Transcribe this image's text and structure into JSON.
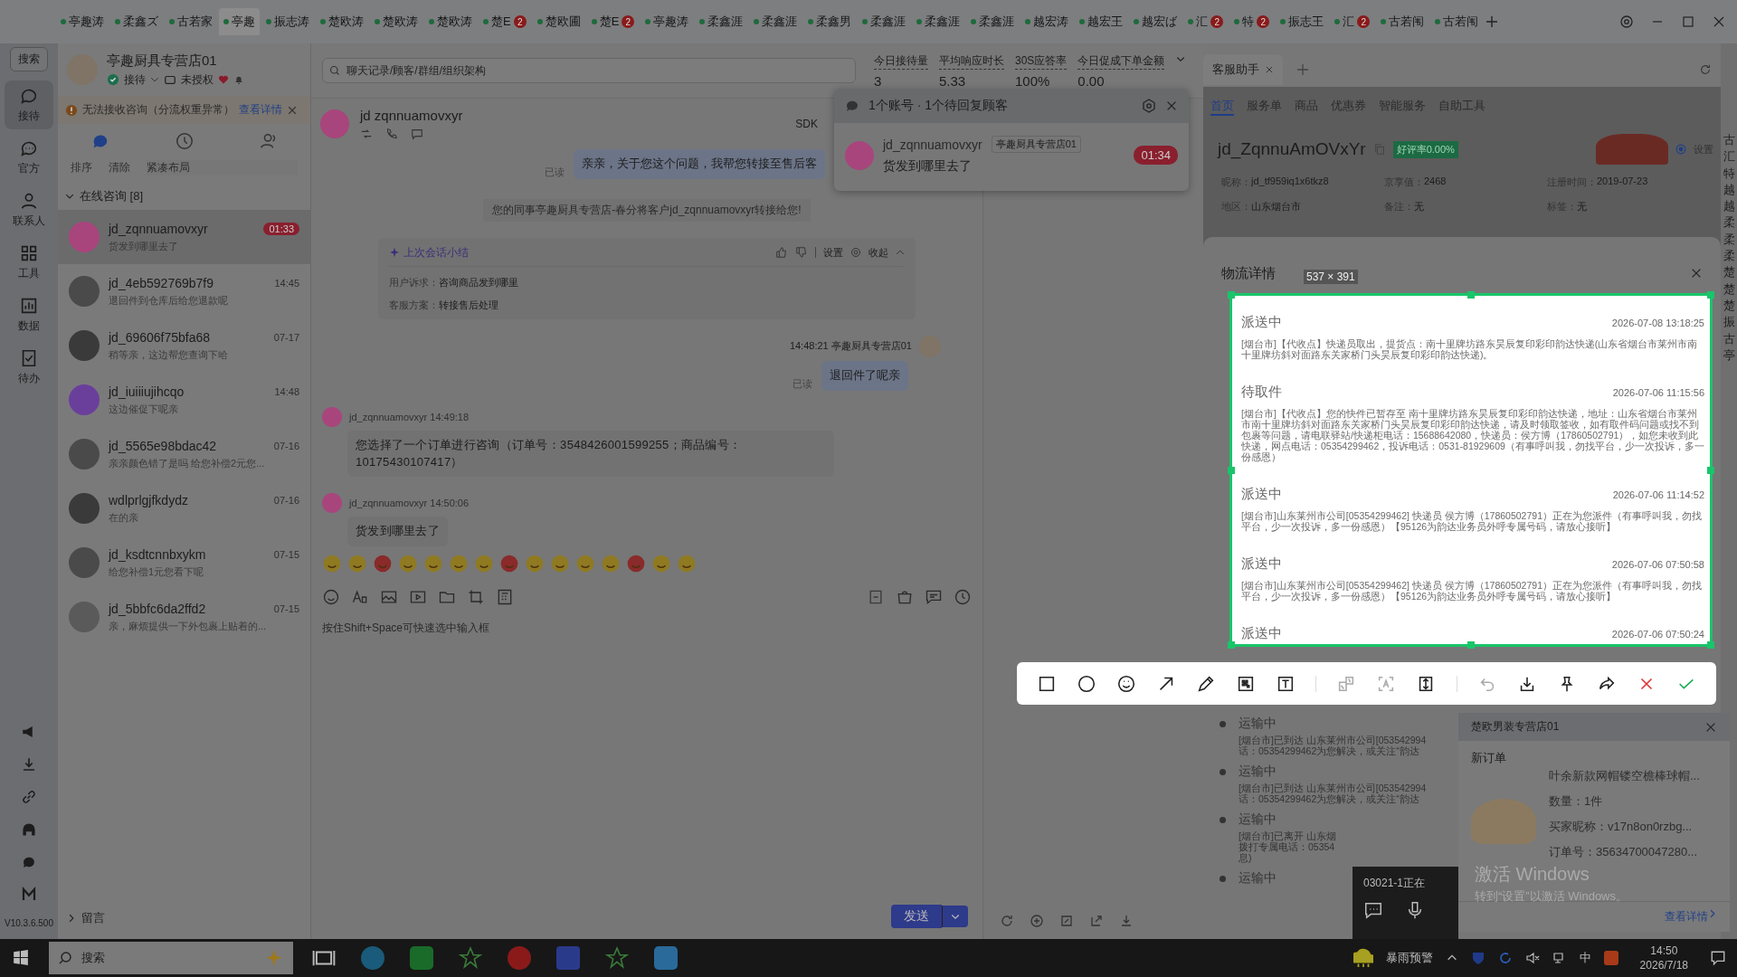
{
  "top_tabs": [
    {
      "label": "亭趣涛",
      "selected": false
    },
    {
      "label": "柔鑫ズ",
      "selected": false
    },
    {
      "label": "古若家",
      "selected": false
    },
    {
      "label": "亭趣",
      "selected": true
    },
    {
      "label": "振志涛",
      "selected": false
    },
    {
      "label": "楚欧涛",
      "selected": false
    },
    {
      "label": "楚欧涛",
      "selected": false
    },
    {
      "label": "楚欧涛",
      "selected": false
    },
    {
      "label": "楚E",
      "badge": "2",
      "selected": false
    },
    {
      "label": "楚欧圃",
      "selected": false
    },
    {
      "label": "楚E",
      "badge": "2",
      "selected": false
    },
    {
      "label": "亭趣涛",
      "selected": false
    },
    {
      "label": "柔鑫涯",
      "selected": false
    },
    {
      "label": "柔鑫涯",
      "selected": false
    },
    {
      "label": "柔鑫男",
      "selected": false
    },
    {
      "label": "柔鑫涯",
      "selected": false
    },
    {
      "label": "柔鑫涯",
      "selected": false
    },
    {
      "label": "柔鑫涯",
      "selected": false
    },
    {
      "label": "越宏涛",
      "selected": false
    },
    {
      "label": "越宏王",
      "selected": false
    },
    {
      "label": "越宏ば",
      "selected": false
    },
    {
      "label": "汇",
      "badge": "2",
      "selected": false
    },
    {
      "label": "特",
      "badge": "2",
      "selected": false
    },
    {
      "label": "振志王",
      "selected": false
    },
    {
      "label": "汇",
      "badge": "2",
      "selected": false
    },
    {
      "label": "古若闱",
      "selected": false
    },
    {
      "label": "古若闱",
      "selected": false
    }
  ],
  "rail": {
    "search": "搜索",
    "items": [
      {
        "label": "接待",
        "selected": true
      },
      {
        "label": "官方",
        "selected": false
      },
      {
        "label": "联系人",
        "selected": false
      },
      {
        "label": "工具",
        "selected": false
      },
      {
        "label": "数据",
        "selected": false
      },
      {
        "label": "待办",
        "selected": false
      }
    ],
    "version": "V10.3.6.500"
  },
  "store": {
    "name": "亭趣厨具专营店01",
    "status": "接待",
    "auth": "未授权"
  },
  "warning": {
    "text": "无法接收咨询（分流权重异常）",
    "link": "查看详情"
  },
  "list_tools": [
    "排序",
    "清除",
    "紧凑布局"
  ],
  "group": {
    "label": "在线咨询 [8]",
    "expanded": true
  },
  "conversations": [
    {
      "name": "jd_zqnnuamovxyr",
      "preview": "货发到哪里去了",
      "time": "01:33",
      "urgent": true,
      "selected": true,
      "color": "#a8457c"
    },
    {
      "name": "jd_4eb592769b7f9",
      "preview": "退回件到仓库后给您退款呢",
      "time": "14:45",
      "urgent": false,
      "selected": false,
      "color": "#4a4a4a"
    },
    {
      "name": "jd_69606f75bfa68",
      "preview": "稍等亲，这边帮您查询下哈",
      "time": "07-17",
      "urgent": false,
      "selected": false,
      "color": "#3a3a3a"
    },
    {
      "name": "jd_iuiiiujihcqo",
      "preview": "这边催促下呢亲",
      "time": "14:48",
      "urgent": false,
      "selected": false,
      "color": "#6a3f9c"
    },
    {
      "name": "jd_5565e98bdac42",
      "preview": "亲亲颜色错了是吗 给您补偿2元您...",
      "time": "07-16",
      "urgent": false,
      "selected": false,
      "color": "#4a4a4a"
    },
    {
      "name": "wdlprlgjfkdydz",
      "preview": "在的亲",
      "time": "07-16",
      "urgent": false,
      "selected": false,
      "color": "#3a3a3a"
    },
    {
      "name": "jd_ksdtcnnbxykm",
      "preview": "给您补偿1元您看下呢",
      "time": "07-15",
      "urgent": false,
      "selected": false,
      "color": "#4a4a4a"
    },
    {
      "name": "jd_5bbfc6da2ffd2",
      "preview": "亲，麻烦提供一下外包裹上贴着的...",
      "time": "07-15",
      "urgent": false,
      "selected": false,
      "color": "#5a5a5a"
    }
  ],
  "footer_group": "留言",
  "search": {
    "placeholder": "聊天记录/顾客/群组/组织架构"
  },
  "stats": [
    {
      "label": "今日接待量",
      "value": "3"
    },
    {
      "label": "平均响应时长",
      "value": "5.33"
    },
    {
      "label": "30S应答率",
      "value": "100%"
    },
    {
      "label": "今日促成下单金额",
      "value": "0.00"
    }
  ],
  "chat": {
    "name": "jd zqnnuamovxyr",
    "sdk": "SDK",
    "messages": [
      {
        "kind": "out",
        "status": "已读",
        "text": "亲亲，关于您这个问题，我帮您转接至售后客"
      },
      {
        "kind": "system",
        "text": "您的同事亭趣厨具专营店-春分将客户jd_zqnnuamovxyr转接给您!"
      },
      {
        "kind": "summary",
        "title": "上次会话小结",
        "settings": "设置",
        "collapse": "收起",
        "rows": [
          {
            "label": "用户诉求：",
            "value": "咨询商品发到哪里"
          },
          {
            "label": "客服方案：",
            "value": "转接售后处理"
          }
        ]
      },
      {
        "kind": "out",
        "time": "14:48:21",
        "sender": "亭趣厨具专营店01",
        "status": "已读",
        "text": "退回件了呢亲"
      },
      {
        "kind": "in",
        "sender": "jd_zqnnuamovxyr",
        "time": "14:49:18",
        "text": "您选择了一个订单进行咨询（订单号：3548426001599255；商品编号：10175430107417）"
      },
      {
        "kind": "in",
        "sender": "jd_zqnnuamovxyr",
        "time": "14:50:06",
        "text": "货发到哪里去了"
      }
    ],
    "input_placeholder": "按住Shift+Space可快速选中输入框",
    "send": "发送"
  },
  "pending_popup": {
    "title": "1个账号 · 1个待回复顾客",
    "name": "jd_zqnnuamovxyr",
    "shop": "亭趣厨具专营店01",
    "text": "货发到哪里去了",
    "timer": "01:34"
  },
  "assistant": {
    "tab": "客服助手",
    "nav": [
      {
        "label": "首页",
        "selected": true
      },
      {
        "label": "服务单",
        "selected": false
      },
      {
        "label": "商品",
        "selected": false
      },
      {
        "label": "优惠券",
        "selected": false
      },
      {
        "label": "智能服务",
        "selected": false
      },
      {
        "label": "自助工具",
        "selected": false
      }
    ],
    "customer": "jd_ZqnnuAmOVxYr",
    "rating": "好评率0.00%",
    "setting": "设置",
    "fields": [
      {
        "label": "昵称：",
        "value": "jd_tf959iq1x6tkz8"
      },
      {
        "label": "京享值：",
        "value": "2468"
      },
      {
        "label": "注册时间：",
        "value": "2019-07-23"
      },
      {
        "label": "地区：",
        "value": "山东烟台市"
      },
      {
        "label": "备注：",
        "value": "无"
      },
      {
        "label": "标签：",
        "value": "无"
      }
    ]
  },
  "logistics": {
    "title": "物流详情",
    "selection_size": "537 × 391",
    "selected_events": [
      {
        "status": "派送中",
        "time": "2026-07-08 13:18:25",
        "detail": "[烟台市]【代收点】快递员取出，提货点：南十里牌坊路东昊辰复印彩印韵达快递(山东省烟台市莱州市南十里牌坊斜对面路东关家桥门头昊辰复印彩印韵达快递)。"
      },
      {
        "status": "待取件",
        "time": "2026-07-06 11:15:56",
        "detail": "[烟台市]【代收点】您的快件已暂存至 南十里牌坊路东昊辰复印彩印韵达快递，地址：山东省烟台市莱州市南十里牌坊斜对面路东关家桥门头昊辰复印彩印韵达快递，请及时领取签收，如有取件码问题或找不到包裹等问题，请电联驿站/快递柜电话：15688642080，快递员：侯方博（17860502791），如您未收到此快递，网点电话：05354299462，投诉电话：0531-81929609（有事呼叫我，勿找平台，少一次投诉，多一份感恩）"
      },
      {
        "status": "派送中",
        "time": "2026-07-06 11:14:52",
        "detail": "[烟台市]山东莱州市公司[05354299462] 快递员 侯方博（17860502791）正在为您派件（有事呼叫我，勿找平台，少一次投诉，多一份感恩）【95126为韵达业务员外呼专属号码，请放心接听】"
      },
      {
        "status": "派送中",
        "time": "2026-07-06 07:50:58",
        "detail": "[烟台市]山东莱州市公司[05354299462] 快递员 侯方博（17860502791）正在为您派件（有事呼叫我，勿找平台，少一次投诉，多一份感恩）【95126为韵达业务员外呼专属号码，请放心接听】"
      },
      {
        "status": "派送中",
        "time": "2026-07-06 07:50:24"
      }
    ],
    "events": [
      {
        "status": "运输中",
        "lines": [
          "[烟台市]已到达 山东莱州市公司[053542994",
          "话：05354299462为您解决，或关注“韵达"
        ]
      },
      {
        "status": "运输中",
        "lines": [
          "[烟台市]已到达 山东莱州市公司[053542994",
          "话：05354299462为您解决，或关注“韵达"
        ]
      },
      {
        "status": "运输中",
        "lines": [
          "[烟台市]已离开 山东烟",
          "拨打专属电话：05354",
          "息)"
        ]
      },
      {
        "status": "运输中"
      }
    ]
  },
  "side_strip": [
    "古",
    "汇",
    "特",
    "越",
    "越",
    "柔",
    "柔",
    "柔",
    "楚",
    "楚",
    "楚",
    "振",
    "古",
    "亭"
  ],
  "notification": {
    "shop": "楚欧男装专营店01",
    "title": "新订单",
    "product": "叶余新款网帽镂空檐棒球帽...",
    "quantity": "数量：1件",
    "buyer": "买家昵称：v17n8on0rzbg...",
    "order": "订单号：35634700047280...",
    "link": "查看详情"
  },
  "call_widget": {
    "text": "03021-1正在"
  },
  "windows_activation": {
    "title": "激活 Windows",
    "text": "转到“设置”以激活 Windows。"
  },
  "taskbar": {
    "search": "搜索",
    "weather": "暴雨预警",
    "ime": "中",
    "time": "14:50",
    "date": "2026/7/18"
  }
}
